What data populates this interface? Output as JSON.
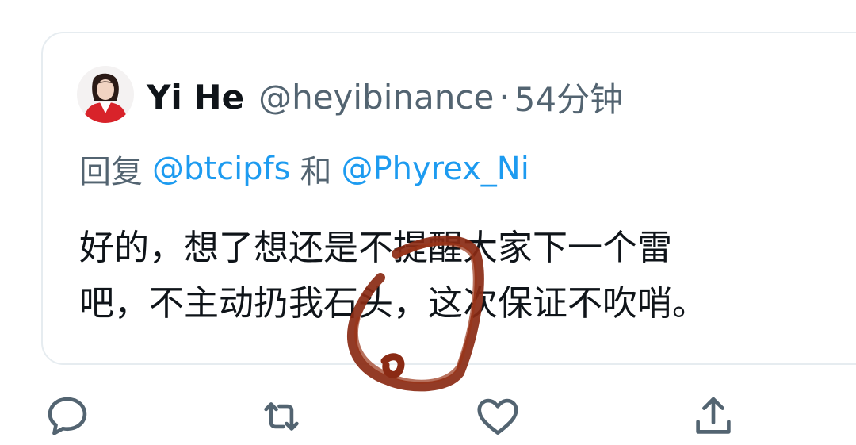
{
  "tweet": {
    "display_name": "Yi He",
    "handle": "@heyibinance",
    "separator": "·",
    "timestamp": "54分钟",
    "reply_prefix": "回复",
    "reply_to_1": "@btcipfs",
    "reply_joiner": "和",
    "reply_to_2": "@Phyrex_Ni",
    "body_line_1": "好的，想了想还是不提醒大家下一个雷",
    "body_line_2": "吧，不主动扔我石头，这次保证不吹哨。"
  },
  "actions": {
    "reply_icon": "comment-icon",
    "retweet_icon": "retweet-icon",
    "like_icon": "heart-icon",
    "share_icon": "share-icon"
  },
  "colors": {
    "text_primary": "#0f1419",
    "text_secondary": "#536471",
    "mention": "#1d9bf0",
    "card_border": "#e6ecf0",
    "scribble": "#8a2a14",
    "avatar_red": "#d8232a"
  }
}
